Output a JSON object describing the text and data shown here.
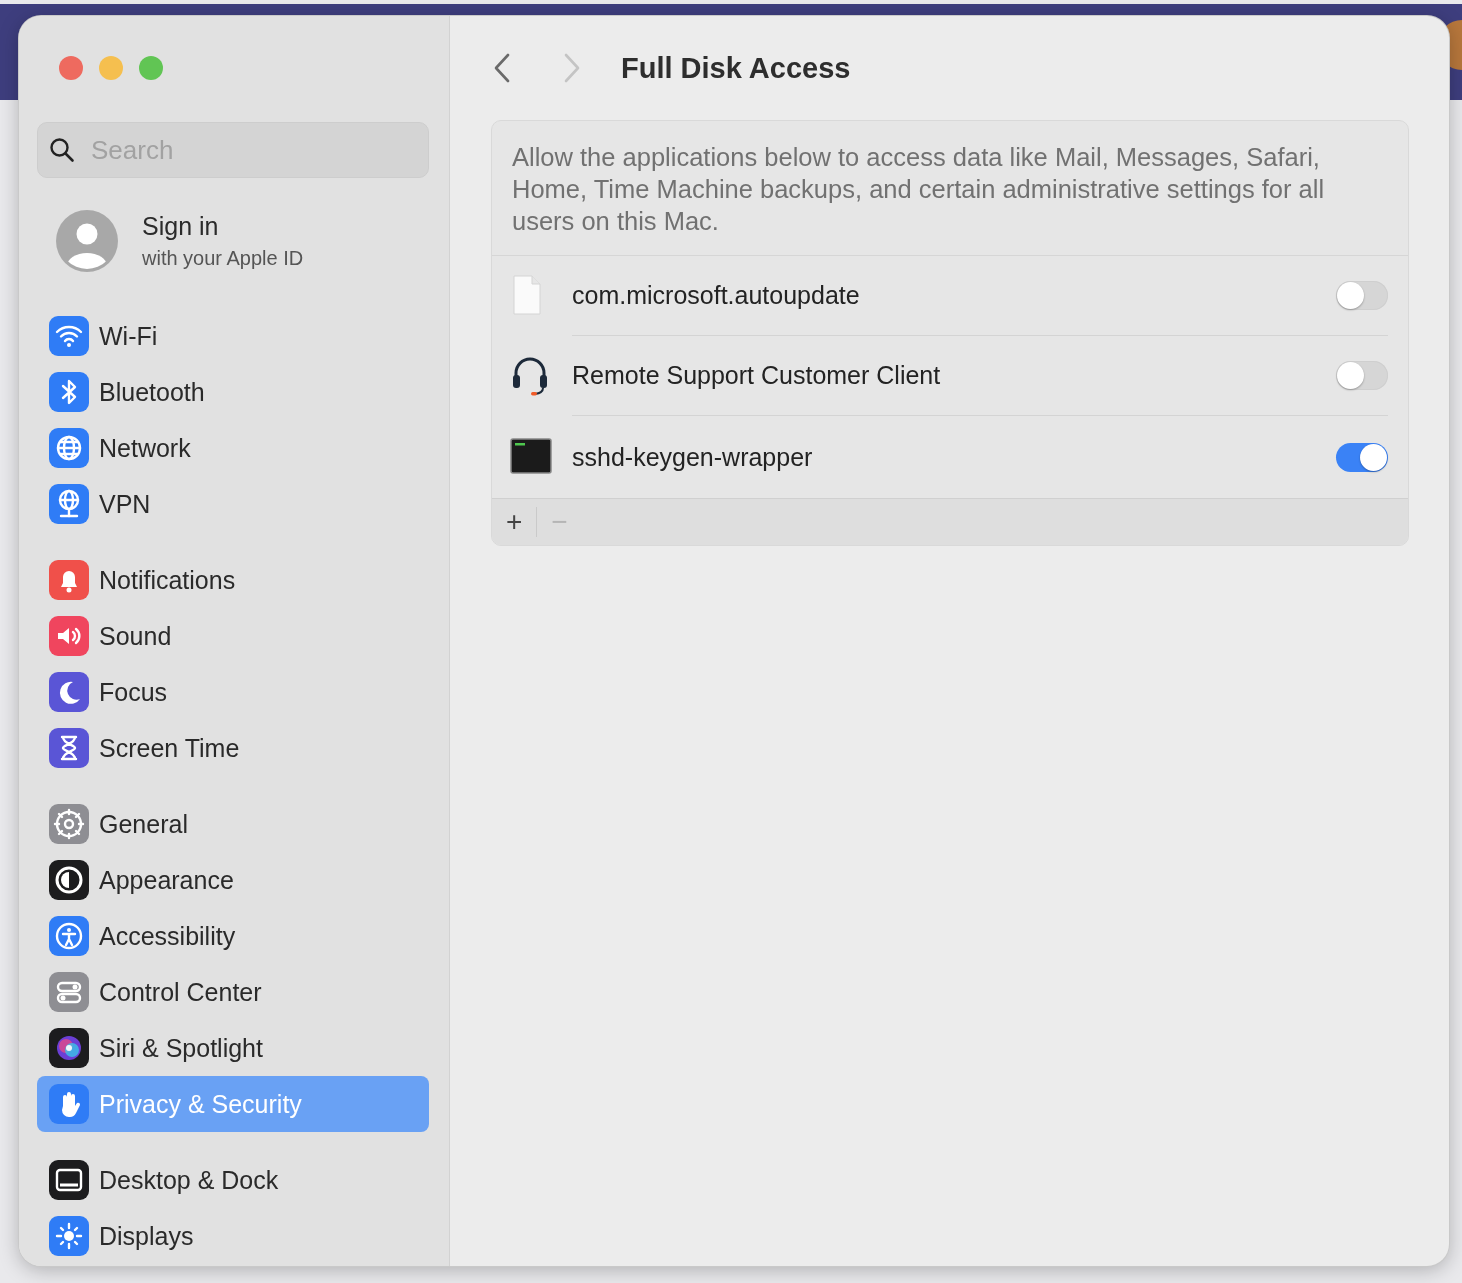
{
  "window": {
    "title": "Full Disk Access",
    "back_enabled": true,
    "forward_enabled": false
  },
  "sidebar": {
    "search": {
      "placeholder": "Search"
    },
    "account": {
      "title": "Sign in",
      "subtitle": "with your Apple ID"
    },
    "groups": [
      {
        "items": [
          {
            "label": "Wi-Fi",
            "kind": "wifi",
            "selected": false
          },
          {
            "label": "Bluetooth",
            "kind": "bluetooth",
            "selected": false
          },
          {
            "label": "Network",
            "kind": "network",
            "selected": false
          },
          {
            "label": "VPN",
            "kind": "vpn",
            "selected": false
          }
        ]
      },
      {
        "items": [
          {
            "label": "Notifications",
            "kind": "notifications",
            "selected": false
          },
          {
            "label": "Sound",
            "kind": "sound",
            "selected": false
          },
          {
            "label": "Focus",
            "kind": "focus",
            "selected": false
          },
          {
            "label": "Screen Time",
            "kind": "screentime",
            "selected": false
          }
        ]
      },
      {
        "items": [
          {
            "label": "General",
            "kind": "general",
            "selected": false
          },
          {
            "label": "Appearance",
            "kind": "appearance",
            "selected": false
          },
          {
            "label": "Accessibility",
            "kind": "accessibility",
            "selected": false
          },
          {
            "label": "Control Center",
            "kind": "controlcenter",
            "selected": false
          },
          {
            "label": "Siri & Spotlight",
            "kind": "siri",
            "selected": false
          },
          {
            "label": "Privacy & Security",
            "kind": "privacy",
            "selected": true
          }
        ]
      },
      {
        "items": [
          {
            "label": "Desktop & Dock",
            "kind": "dock",
            "selected": false
          },
          {
            "label": "Displays",
            "kind": "displays",
            "selected": false
          }
        ]
      }
    ]
  },
  "content": {
    "description": "Allow the applications below to access data like Mail, Messages, Safari, Home, Time Machine backups, and certain administrative settings for all users on this Mac.",
    "apps": [
      {
        "name": "com.microsoft.autoupdate",
        "kind": "document",
        "on": false
      },
      {
        "name": "Remote Support Customer Client",
        "kind": "headset",
        "on": false
      },
      {
        "name": "sshd-keygen-wrapper",
        "kind": "terminal",
        "on": true
      }
    ],
    "add_label": "+",
    "remove_label": "−",
    "remove_enabled": false
  }
}
